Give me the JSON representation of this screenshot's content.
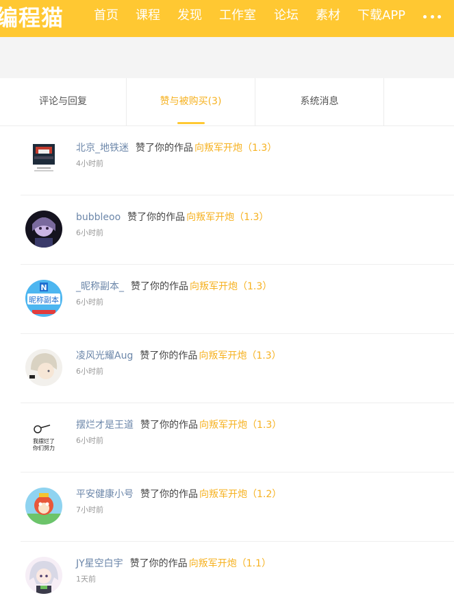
{
  "header": {
    "logo": "编程猫",
    "nav": [
      "首页",
      "课程",
      "发现",
      "工作室",
      "论坛",
      "素材",
      "下载APP"
    ],
    "more_icon": "more-dots-icon",
    "brand_color": "#ffc832"
  },
  "tabs": [
    "评论与回复",
    "赞与被购买(3)",
    "系统消息"
  ],
  "active_tab_color": "#f6b11f",
  "notifications": [
    {
      "user": "北京_地铁迷",
      "action": "赞了你的作品",
      "work": "向叛军开炮（1.3）",
      "time": "4小时前",
      "avatar_text": "北京 地铁迷"
    },
    {
      "user": "bubbleoo",
      "action": "赞了你的作品",
      "work": "向叛军开炮（1.3）",
      "time": "6小时前"
    },
    {
      "user": "_昵称副本_",
      "action": "赞了你的作品",
      "work": "向叛军开炮（1.3）",
      "time": "6小时前",
      "avatar_text": "昵称副本"
    },
    {
      "user": "凌风光耀Aug",
      "action": "赞了你的作品",
      "work": "向叛军开炮（1.3）",
      "time": "6小时前"
    },
    {
      "user": "摆烂才是王道",
      "action": "赞了你的作品",
      "work": "向叛军开炮（1.3）",
      "time": "6小时前",
      "avatar_text": "我摆烂了 你们努力"
    },
    {
      "user": "平安健康小号",
      "action": "赞了你的作品",
      "work": "向叛军开炮（1.2）",
      "time": "7小时前"
    },
    {
      "user": "JY星空白宇",
      "action": "赞了你的作品",
      "work": "向叛军开炮（1.1）",
      "time": "1天前"
    }
  ]
}
